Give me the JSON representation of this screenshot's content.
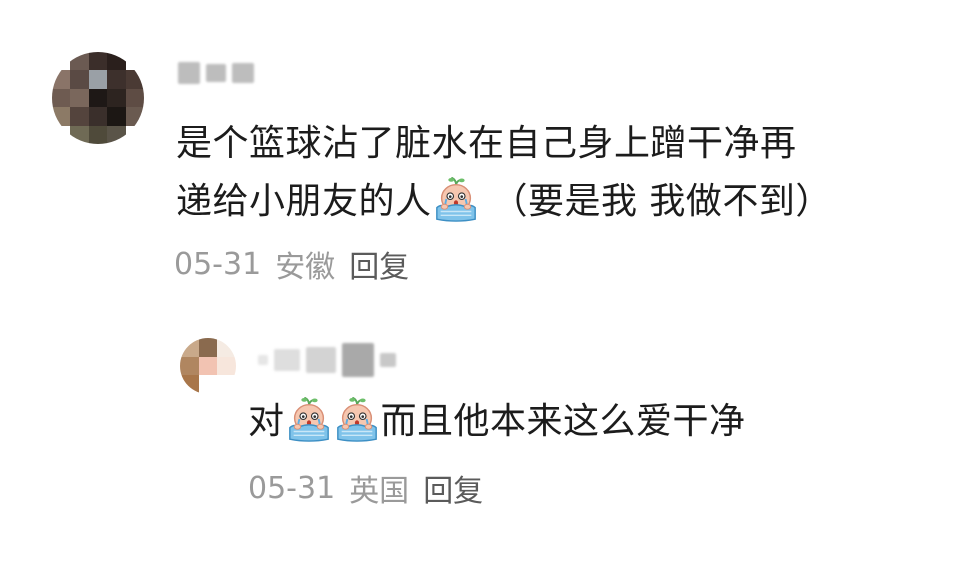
{
  "comment": {
    "text_line1": "是个篮球沾了脏水在自己身上蹭干净再",
    "text_line2_before_emoji": "递给小朋友的人",
    "text_line2_after_emoji": " （要是我 我做不到）",
    "date": "05-31",
    "location": "安徽",
    "reply_label": "回复",
    "emoji_name": "crying-emoji"
  },
  "reply": {
    "text_before_emoji": "对",
    "text_after_emoji": "而且他本来这么爱干净",
    "date": "05-31",
    "location": "英国",
    "reply_label": "回复",
    "emoji_name": "crying-emoji"
  },
  "colors": {
    "text": "#1c1c1c",
    "meta": "#9a9a9a",
    "reply_action": "#5b5b5b",
    "emoji_skin": "#f6c7b0",
    "emoji_blanket": "#7fc3ea",
    "emoji_sprout": "#6dbf6a"
  }
}
